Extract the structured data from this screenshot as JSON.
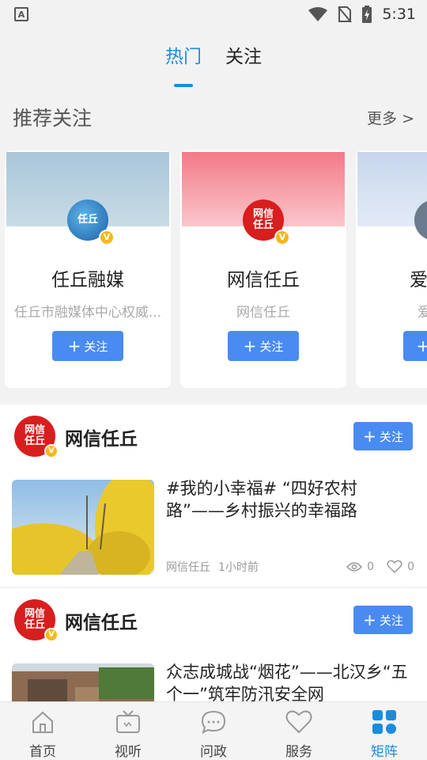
{
  "status_bar": {
    "left_icon": "A",
    "time": "5:31",
    "icons": [
      "wifi-icon",
      "no-sim-icon",
      "battery-charging-icon"
    ]
  },
  "top_tabs": [
    {
      "label": "热门",
      "active": true
    },
    {
      "label": "关注",
      "active": false
    }
  ],
  "recommend": {
    "title": "推荐关注",
    "more_label": "更多 >",
    "cards": [
      {
        "name": "任丘融媒",
        "desc": "任丘市融媒体中心权威...",
        "follow_label": "关注",
        "avatar_text": "任丘",
        "badge": "V"
      },
      {
        "name": "网信任丘",
        "desc": "网信任丘",
        "follow_label": "关注",
        "avatar_text": "网信任丘",
        "badge": "V"
      },
      {
        "name": "爱",
        "desc": "爱",
        "follow_label": "",
        "avatar_text": "",
        "badge": ""
      }
    ]
  },
  "feed": [
    {
      "author": "网信任丘",
      "avatar_text": "网信任丘",
      "badge": "V",
      "follow_label": "关注",
      "title": "#我的小幸福# “四好农村路”——乡村振兴的幸福路",
      "source": "网信任丘",
      "time": "1小时前",
      "views": "0",
      "likes": "0"
    },
    {
      "author": "网信任丘",
      "avatar_text": "网信任丘",
      "badge": "V",
      "follow_label": "关注",
      "title": "众志成城战“烟花”——北汉乡“五个一”筑牢防汛安全网"
    }
  ],
  "bottom_nav": [
    {
      "label": "首页",
      "icon": "home-icon",
      "active": false
    },
    {
      "label": "视听",
      "icon": "tv-icon",
      "active": false
    },
    {
      "label": "问政",
      "icon": "chat-icon",
      "active": false
    },
    {
      "label": "服务",
      "icon": "heart-icon",
      "active": false
    },
    {
      "label": "矩阵",
      "icon": "grid-icon",
      "active": true
    }
  ],
  "colors": {
    "accent": "#1a8ce0",
    "button": "#4a8bf2",
    "brand_red": "#d81e1e",
    "badge": "#f5b71c"
  }
}
